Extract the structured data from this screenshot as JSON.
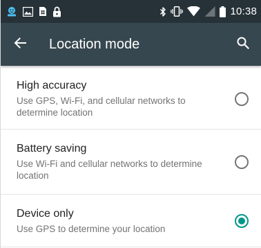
{
  "status_bar": {
    "time": "10:38",
    "icons_left": [
      "app-notification-icon",
      "image-icon",
      "sim-card-icon",
      "lock-icon"
    ],
    "icons_right": [
      "bluetooth-icon",
      "vibrate-icon",
      "wifi-icon",
      "no-signal-icon",
      "battery-icon"
    ],
    "bg_color": "#263238"
  },
  "toolbar": {
    "title": "Location mode",
    "back_icon": "arrow-back-icon",
    "search_icon": "search-icon",
    "bg_color": "#37474f"
  },
  "options": [
    {
      "title": "High accuracy",
      "summary": "Use GPS, Wi-Fi, and cellular networks to determine location",
      "checked": false
    },
    {
      "title": "Battery saving",
      "summary": "Use Wi-Fi and cellular networks to determine location",
      "checked": false
    },
    {
      "title": "Device only",
      "summary": "Use GPS to determine your location",
      "checked": true
    }
  ],
  "accent_color": "#009688"
}
